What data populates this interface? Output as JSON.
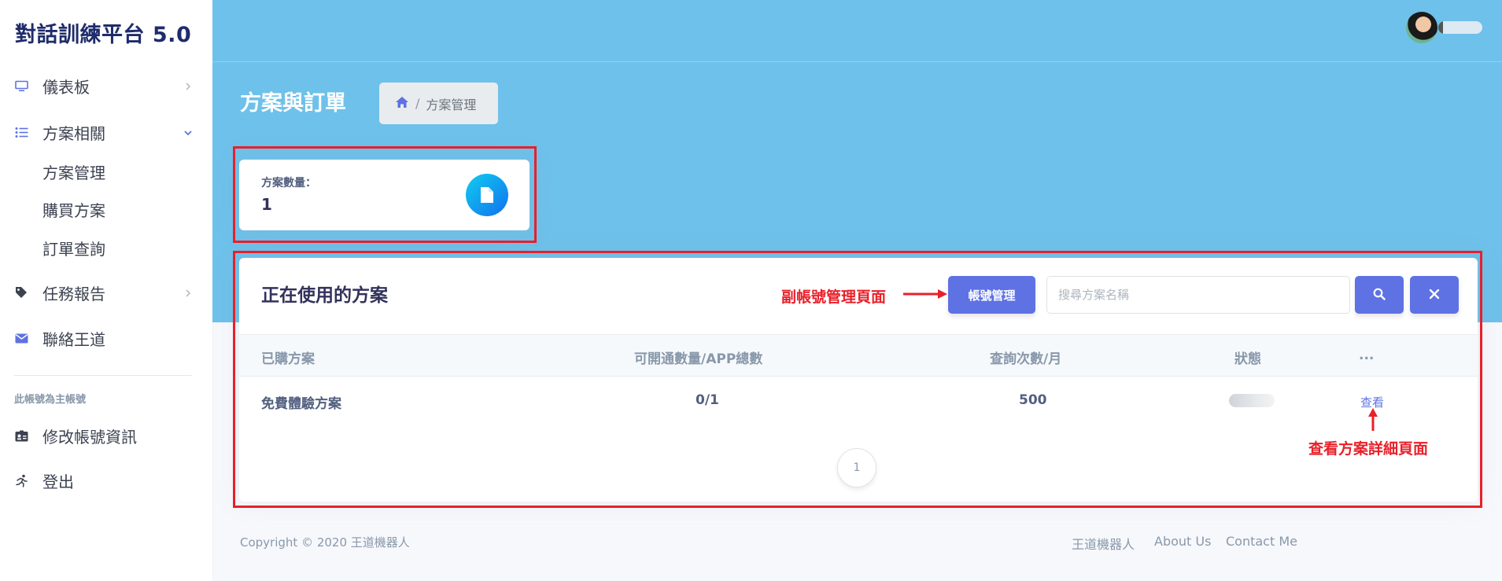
{
  "brand": "對話訓練平台 5.0",
  "sidebar": {
    "items": [
      {
        "label": "儀表板"
      },
      {
        "label": "方案相關"
      },
      {
        "label": "任務報告"
      },
      {
        "label": "聯絡王道"
      }
    ],
    "sub_items": [
      "方案管理",
      "購買方案",
      "訂單查詢"
    ],
    "section_note": "此帳號為主帳號",
    "account_items": [
      {
        "label": "修改帳號資訊"
      },
      {
        "label": "登出"
      }
    ]
  },
  "header": {
    "page_title": "方案與訂單",
    "breadcrumb": {
      "separator": "/",
      "current": "方案管理"
    }
  },
  "stat": {
    "label": "方案數量：",
    "value": "1"
  },
  "plans": {
    "title": "正在使用的方案",
    "manage_button": "帳號管理",
    "search_placeholder": "搜尋方案名稱",
    "columns": [
      "已購方案",
      "可開通數量/APP總數",
      "查詢次數/月",
      "狀態",
      "..."
    ],
    "rows": [
      {
        "plan": "免費體驗方案",
        "quota": "0/1",
        "queries": "500",
        "action": "查看"
      }
    ],
    "pagination": {
      "current": "1"
    }
  },
  "annotations": {
    "sub_account": "副帳號管理頁面",
    "view_detail": "查看方案詳細頁面"
  },
  "footer": {
    "copyright": "Copyright © 2020 王道機器人",
    "links": [
      "王道機器人",
      "About Us",
      "Contact Me"
    ]
  },
  "colors": {
    "banner": "#6ec1ea",
    "primary": "#5e72e4",
    "annotation_red": "#e8202a",
    "brand_text": "#1f2c6b"
  }
}
